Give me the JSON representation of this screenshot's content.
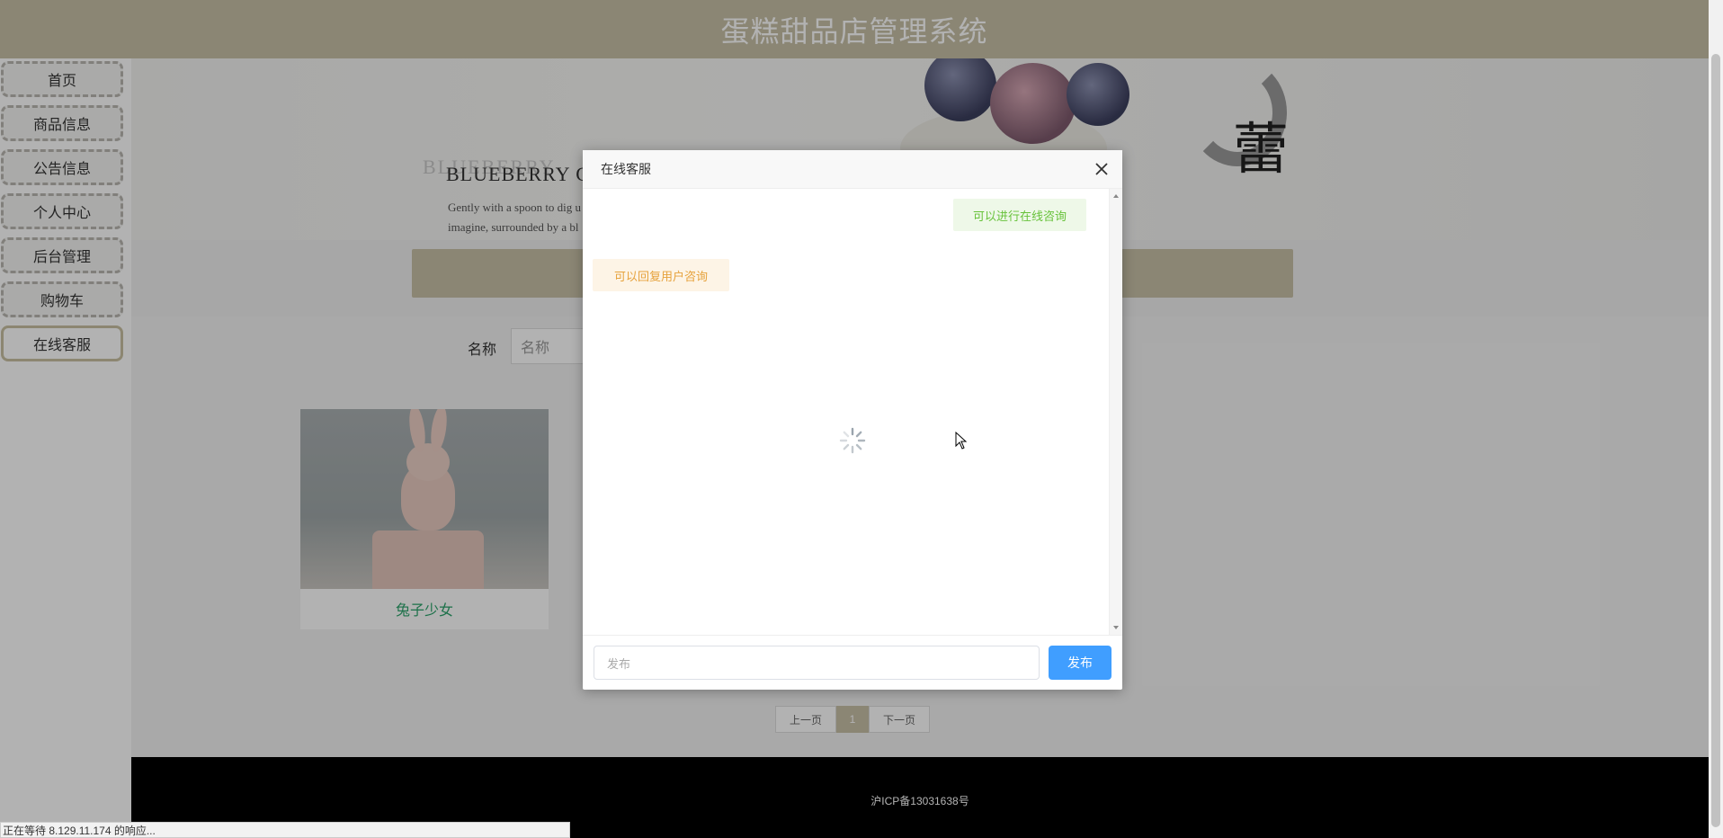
{
  "header": {
    "title": "蛋糕甜品店管理系统"
  },
  "sidebar": {
    "items": [
      {
        "label": "首页"
      },
      {
        "label": "商品信息"
      },
      {
        "label": "公告信息"
      },
      {
        "label": "个人中心"
      },
      {
        "label": "后台管理"
      },
      {
        "label": "购物车"
      },
      {
        "label": "在线客服",
        "active": true
      }
    ]
  },
  "banner": {
    "heading_shadow": "BLUEBERRY",
    "heading": "BLUEBERRY  CA",
    "desc_line1": "Gently with a spoon to dig u",
    "desc_line2": "imagine, surrounded by a bl",
    "cn_char_big": "蕾"
  },
  "search": {
    "label": "名称",
    "placeholder": "名称"
  },
  "products": [
    {
      "name": "兔子少女"
    }
  ],
  "pagination": {
    "prev": "上一页",
    "current": "1",
    "next": "下一页"
  },
  "footer": {
    "icp": "沪ICP备13031638号"
  },
  "modal": {
    "title": "在线客服",
    "messages": [
      {
        "side": "right",
        "text": "可以进行在线咨询"
      },
      {
        "side": "left",
        "text": "可以回复用户咨询"
      }
    ],
    "input_placeholder": "发布",
    "send_label": "发布"
  },
  "status": {
    "text": "正在等待 8.129.11.174 的响应..."
  },
  "colors": {
    "brand": "#c8c1a6",
    "send_button": "#409eff",
    "bubble_right_text": "#67c23a",
    "bubble_left_text": "#e6a23c",
    "product_name": "#2aa36a"
  }
}
